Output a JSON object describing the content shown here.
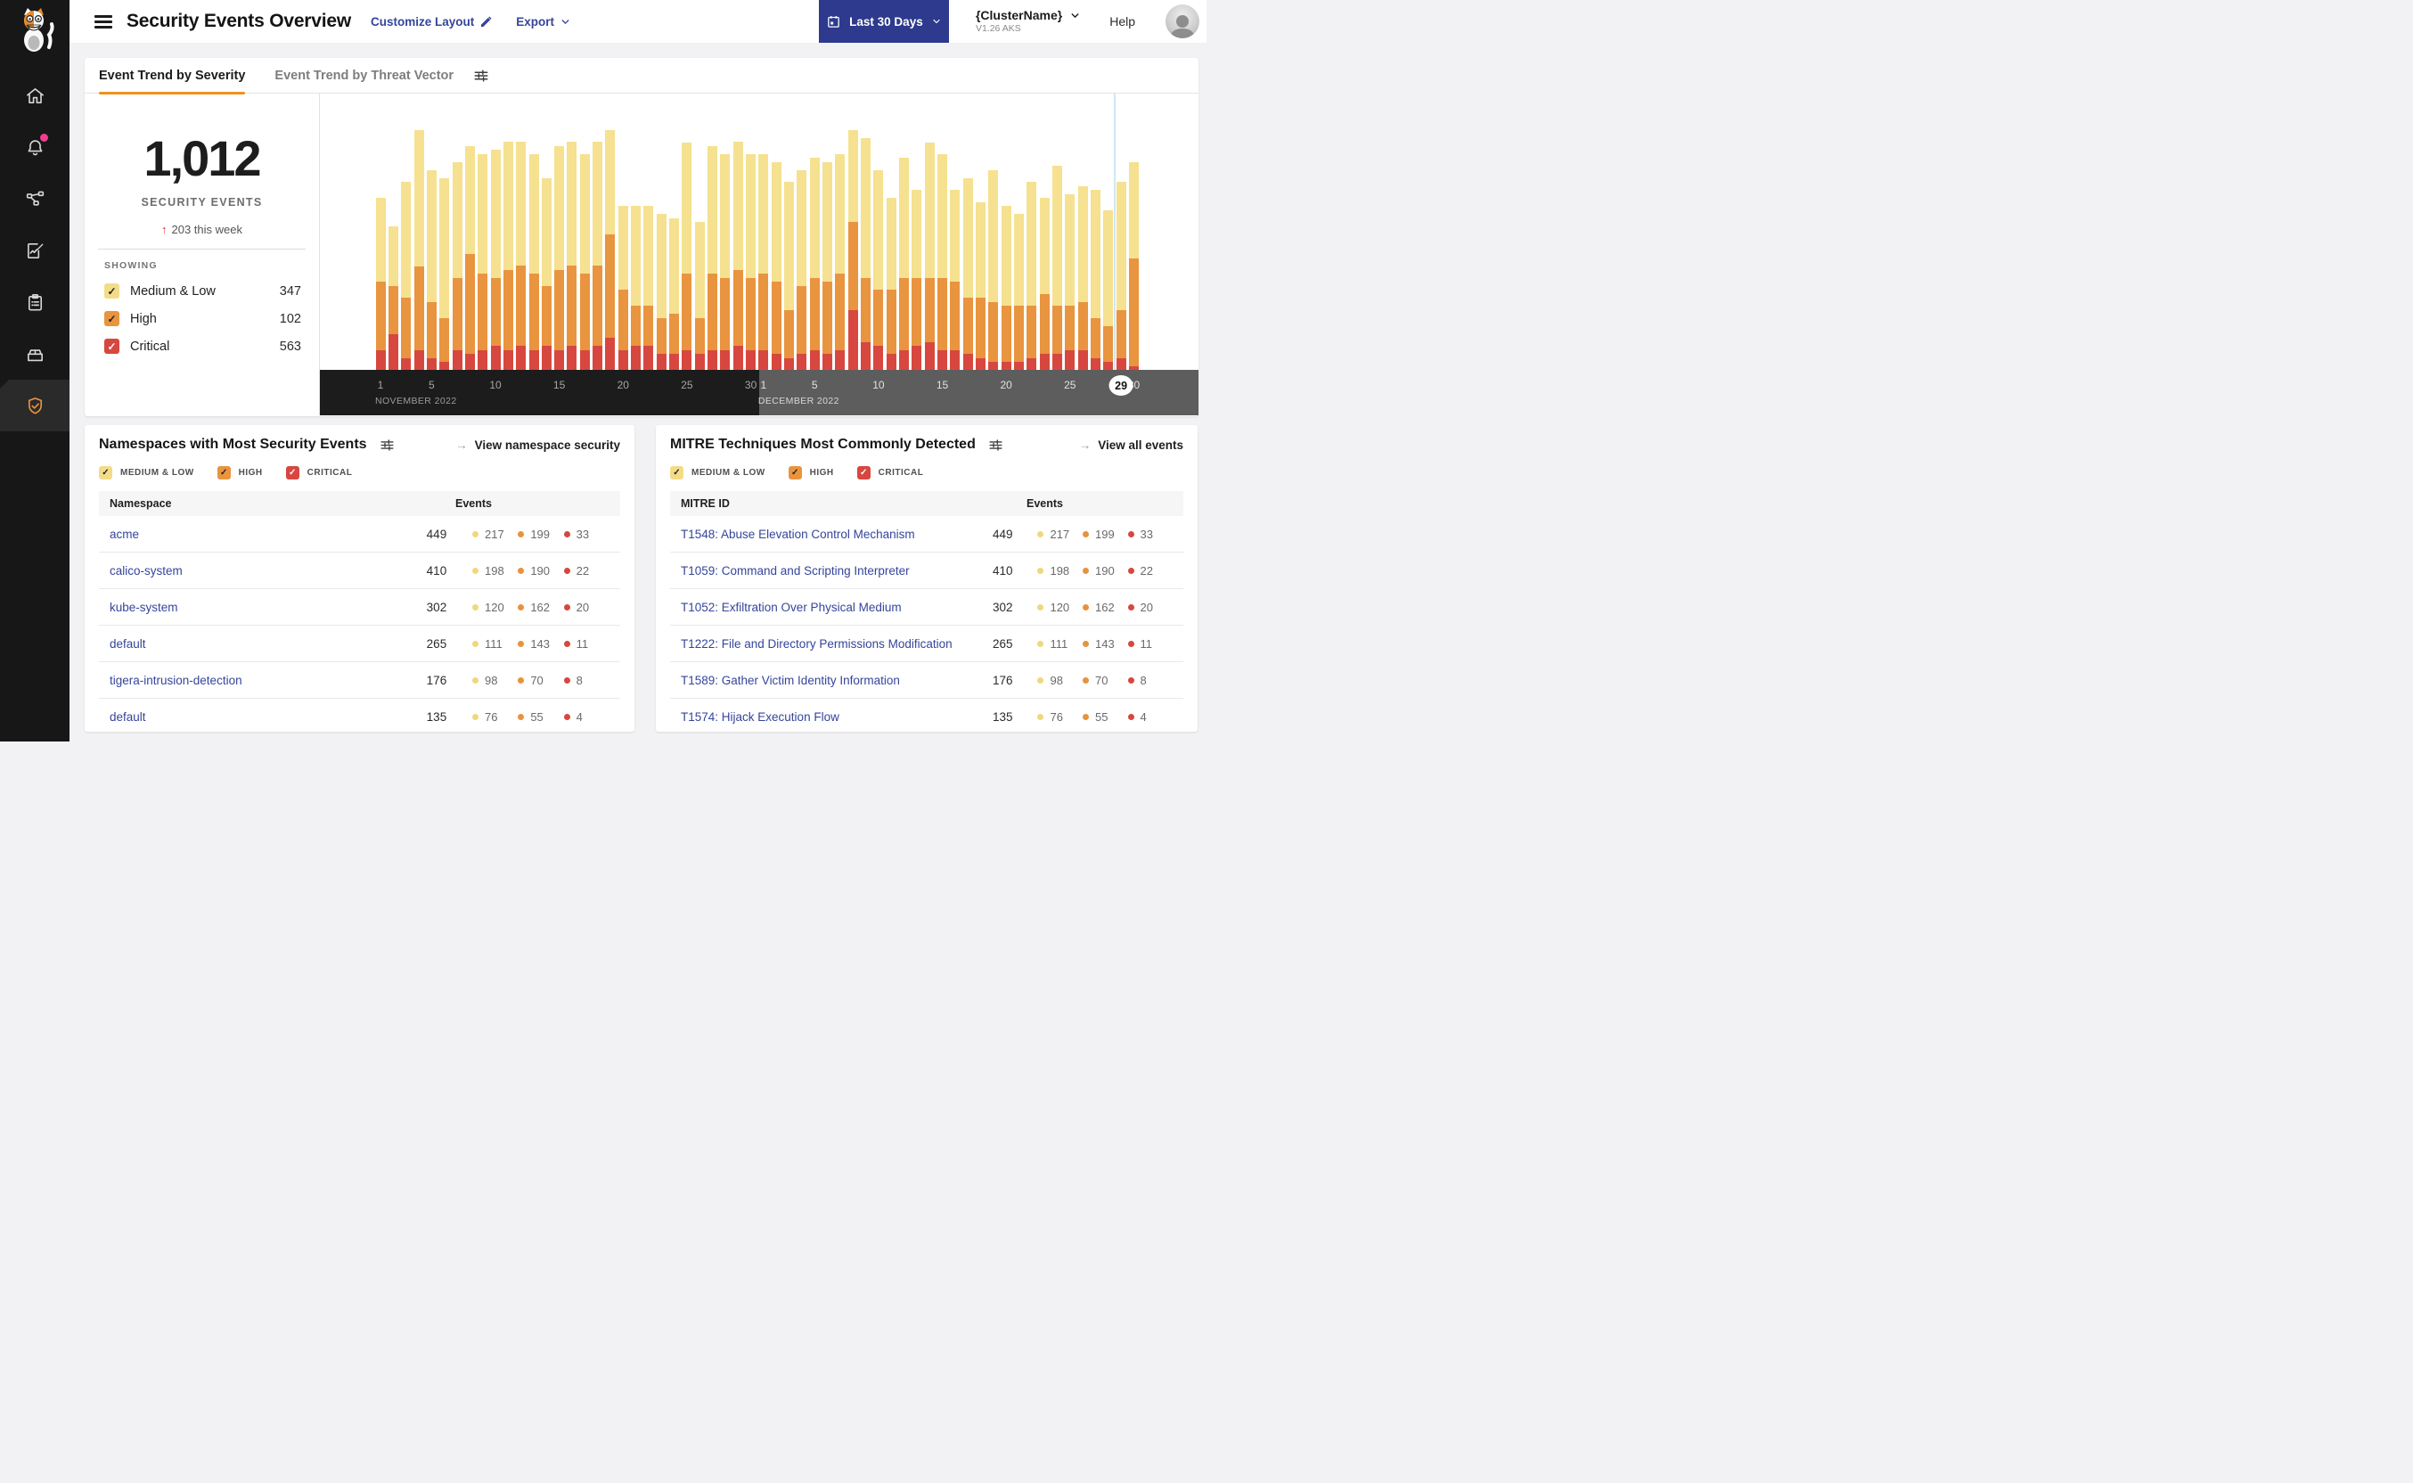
{
  "header": {
    "title": "Security Events Overview",
    "customize_label": "Customize Layout",
    "export_label": "Export",
    "date_range": "Last 30 Days",
    "cluster_name": "{ClusterName}",
    "cluster_version": "V1.26 AKS",
    "help_label": "Help"
  },
  "sidebar": {
    "items": [
      {
        "icon": "home-icon",
        "active": false,
        "badge": false
      },
      {
        "icon": "alerts-bell-icon",
        "active": false,
        "badge": true
      },
      {
        "icon": "service-graph-icon",
        "active": false,
        "badge": false
      },
      {
        "icon": "policies-edit-icon",
        "active": false,
        "badge": false
      },
      {
        "icon": "compliance-clipboard-icon",
        "active": false,
        "badge": false
      },
      {
        "icon": "workloads-box-icon",
        "active": false,
        "badge": false
      },
      {
        "icon": "threat-defense-shield-icon",
        "active": true,
        "badge": false
      }
    ],
    "badge_color": "#ef3e8f",
    "active_icon_color": "#e89540"
  },
  "chart_card": {
    "tabs": [
      {
        "label": "Event Trend by Severity",
        "active": true
      },
      {
        "label": "Event Trend by Threat Vector",
        "active": false
      }
    ],
    "summary": {
      "total": "1,012",
      "caption": "SECURITY EVENTS",
      "delta_arrow": "↑",
      "delta_text": "203 this week"
    },
    "showing": {
      "label": "SHOWING",
      "items": [
        {
          "label": "Medium & Low",
          "count": "347",
          "box": "#f3dc88",
          "check": "#222222"
        },
        {
          "label": "High",
          "count": "102",
          "box": "#e9943f",
          "check": "#222222"
        },
        {
          "label": "Critical",
          "count": "563",
          "box": "#d7473f",
          "check": "#ffffff"
        }
      ]
    },
    "chart_data": {
      "type": "bar",
      "stacked": true,
      "ylim": [
        0,
        60
      ],
      "grid": false,
      "colors": {
        "medium_low": "#f5e190",
        "high": "#e9943f",
        "critical": "#d7473f"
      },
      "months": [
        {
          "label": "NOVEMBER 2022",
          "days": 30,
          "tick_days": [
            1,
            5,
            10,
            15,
            20,
            25,
            30
          ]
        },
        {
          "label": "DECEMBER 2022",
          "days": 30,
          "tick_days": [
            1,
            5,
            10,
            15,
            20,
            25,
            30
          ]
        }
      ],
      "selected_day": {
        "month_index": 1,
        "day": 29
      },
      "series": [
        {
          "name": "Medium & Low",
          "values": [
            21,
            15,
            29,
            34,
            33,
            35,
            29,
            27,
            30,
            32,
            32,
            31,
            30,
            27,
            31,
            31,
            30,
            31,
            26,
            21,
            25,
            25,
            26,
            24,
            33,
            24,
            32,
            31,
            32,
            31,
            30,
            30,
            32,
            29,
            30,
            30,
            30,
            23,
            35,
            30,
            23,
            30,
            22,
            34,
            31,
            23,
            30,
            24,
            33,
            25,
            23,
            31,
            24,
            35,
            28,
            29,
            32,
            29,
            32,
            24
          ]
        },
        {
          "name": "High",
          "values": [
            17,
            12,
            15,
            21,
            14,
            11,
            18,
            25,
            19,
            17,
            20,
            20,
            19,
            15,
            20,
            20,
            19,
            20,
            26,
            15,
            10,
            10,
            9,
            10,
            19,
            9,
            19,
            18,
            19,
            18,
            19,
            18,
            12,
            17,
            18,
            18,
            19,
            22,
            16,
            14,
            16,
            18,
            17,
            16,
            18,
            17,
            14,
            15,
            15,
            14,
            14,
            13,
            15,
            12,
            11,
            12,
            10,
            9,
            12,
            27
          ]
        },
        {
          "name": "Critical",
          "values": [
            5,
            9,
            3,
            5,
            3,
            2,
            5,
            4,
            5,
            6,
            5,
            6,
            5,
            6,
            5,
            6,
            5,
            6,
            8,
            5,
            6,
            6,
            4,
            4,
            5,
            4,
            5,
            5,
            6,
            5,
            5,
            4,
            3,
            4,
            5,
            4,
            5,
            15,
            7,
            6,
            4,
            5,
            6,
            7,
            5,
            5,
            4,
            3,
            2,
            2,
            2,
            3,
            4,
            4,
            5,
            5,
            3,
            2,
            3,
            1
          ]
        }
      ]
    }
  },
  "namespaces_card": {
    "title": "Namespaces with Most Security Events",
    "link_arrow": "→",
    "link_label": "View namespace security",
    "filters": [
      {
        "label": "MEDIUM & LOW",
        "box": "#f3dc88",
        "check": "#222222"
      },
      {
        "label": "HIGH",
        "box": "#e9943f",
        "check": "#222222"
      },
      {
        "label": "CRITICAL",
        "box": "#d7473f",
        "check": "#ffffff"
      }
    ],
    "columns": [
      "Namespace",
      "Events"
    ],
    "rows": [
      {
        "name": "acme",
        "total": "449",
        "medium_low": "217",
        "high": "199",
        "critical": "33"
      },
      {
        "name": "calico-system",
        "total": "410",
        "medium_low": "198",
        "high": "190",
        "critical": "22"
      },
      {
        "name": "kube-system",
        "total": "302",
        "medium_low": "120",
        "high": "162",
        "critical": "20"
      },
      {
        "name": "default",
        "total": "265",
        "medium_low": "111",
        "high": "143",
        "critical": "11"
      },
      {
        "name": "tigera-intrusion-detection",
        "total": "176",
        "medium_low": "98",
        "high": "70",
        "critical": "8"
      },
      {
        "name": "default",
        "total": "135",
        "medium_low": "76",
        "high": "55",
        "critical": "4"
      }
    ]
  },
  "mitre_card": {
    "title": "MITRE Techniques Most Commonly Detected",
    "link_arrow": "→",
    "link_label": "View all events",
    "filters": [
      {
        "label": "MEDIUM & LOW",
        "box": "#f3dc88",
        "check": "#222222"
      },
      {
        "label": "HIGH",
        "box": "#e9943f",
        "check": "#222222"
      },
      {
        "label": "CRITICAL",
        "box": "#d7473f",
        "check": "#ffffff"
      }
    ],
    "columns": [
      "MITRE ID",
      "Events"
    ],
    "rows": [
      {
        "name": "T1548: Abuse Elevation Control Mechanism",
        "total": "449",
        "medium_low": "217",
        "high": "199",
        "critical": "33"
      },
      {
        "name": "T1059: Command and Scripting Interpreter",
        "total": "410",
        "medium_low": "198",
        "high": "190",
        "critical": "22"
      },
      {
        "name": "T1052: Exfiltration Over Physical Medium",
        "total": "302",
        "medium_low": "120",
        "high": "162",
        "critical": "20"
      },
      {
        "name": "T1222: File and Directory Permissions Modification",
        "total": "265",
        "medium_low": "111",
        "high": "143",
        "critical": "11"
      },
      {
        "name": "T1589: Gather Victim Identity Information",
        "total": "176",
        "medium_low": "98",
        "high": "70",
        "critical": "8"
      },
      {
        "name": "T1574: Hijack Execution Flow",
        "total": "135",
        "medium_low": "76",
        "high": "55",
        "critical": "4"
      }
    ]
  },
  "dot_colors": {
    "medium_low": "#efd87d",
    "high": "#e8923f",
    "critical": "#d6473f"
  }
}
